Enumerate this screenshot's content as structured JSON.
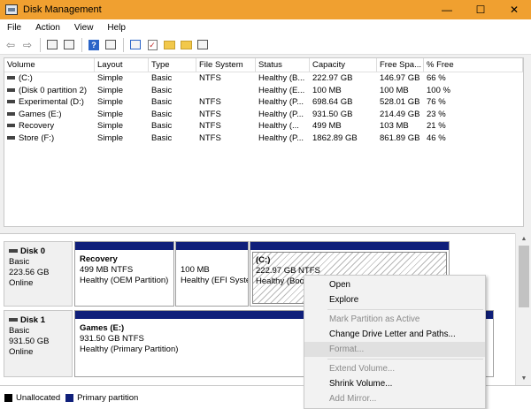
{
  "window": {
    "title": "Disk Management"
  },
  "menubar": [
    "File",
    "Action",
    "View",
    "Help"
  ],
  "toolbar": {
    "icons": [
      "back-arrow-icon",
      "forward-arrow-icon",
      "console-tree-icon",
      "help-icon",
      "properties-icon",
      "connect-icon",
      "check-icon",
      "folder-icon",
      "folder-settings-icon",
      "view-icon"
    ]
  },
  "volume_list": {
    "columns": [
      "Volume",
      "Layout",
      "Type",
      "File System",
      "Status",
      "Capacity",
      "Free Spa...",
      "% Free"
    ],
    "rows": [
      [
        "(C:)",
        "Simple",
        "Basic",
        "NTFS",
        "Healthy (B...",
        "222.97 GB",
        "146.97 GB",
        "66 %"
      ],
      [
        "(Disk 0 partition 2)",
        "Simple",
        "Basic",
        "",
        "Healthy (E...",
        "100 MB",
        "100 MB",
        "100 %"
      ],
      [
        "Experimental (D:)",
        "Simple",
        "Basic",
        "NTFS",
        "Healthy (P...",
        "698.64 GB",
        "528.01 GB",
        "76 %"
      ],
      [
        "Games (E:)",
        "Simple",
        "Basic",
        "NTFS",
        "Healthy (P...",
        "931.50 GB",
        "214.49 GB",
        "23 %"
      ],
      [
        "Recovery",
        "Simple",
        "Basic",
        "NTFS",
        "Healthy (...",
        "499 MB",
        "103 MB",
        "21 %"
      ],
      [
        "Store (F:)",
        "Simple",
        "Basic",
        "NTFS",
        "Healthy (P...",
        "1862.89 GB",
        "861.89 GB",
        "46 %"
      ]
    ]
  },
  "disks": [
    {
      "name": "Disk 0",
      "type": "Basic",
      "size": "223.56 GB",
      "status": "Online",
      "partitions": [
        {
          "name": "Recovery",
          "size": "499 MB NTFS",
          "status": "Healthy (OEM Partition)"
        },
        {
          "name": "",
          "size": "100 MB",
          "status": "Healthy (EFI Syste"
        },
        {
          "name": "(C:)",
          "size": "222.97 GB NTFS",
          "status": "Healthy (Boot"
        }
      ]
    },
    {
      "name": "Disk 1",
      "type": "Basic",
      "size": "931.50 GB",
      "status": "Online",
      "partitions": [
        {
          "name": "Games  (E:)",
          "size": "931.50 GB NTFS",
          "status": "Healthy (Primary Partition)"
        }
      ]
    }
  ],
  "legend": [
    {
      "label": "Unallocated",
      "color": "#000000"
    },
    {
      "label": "Primary partition",
      "color": "#0f1f7a"
    }
  ],
  "context_menu": {
    "items": [
      {
        "label": "Open",
        "enabled": true
      },
      {
        "label": "Explore",
        "enabled": true
      },
      {
        "label": "Mark Partition as Active",
        "enabled": false
      },
      {
        "label": "Change Drive Letter and Paths...",
        "enabled": true
      },
      {
        "label": "Format...",
        "enabled": false
      },
      {
        "label": "Extend Volume...",
        "enabled": false
      },
      {
        "label": "Shrink Volume...",
        "enabled": true
      },
      {
        "label": "Add Mirror...",
        "enabled": false
      }
    ]
  },
  "colors": {
    "title_bar": "#f0a030",
    "partition_band": "#0f1f7a"
  }
}
